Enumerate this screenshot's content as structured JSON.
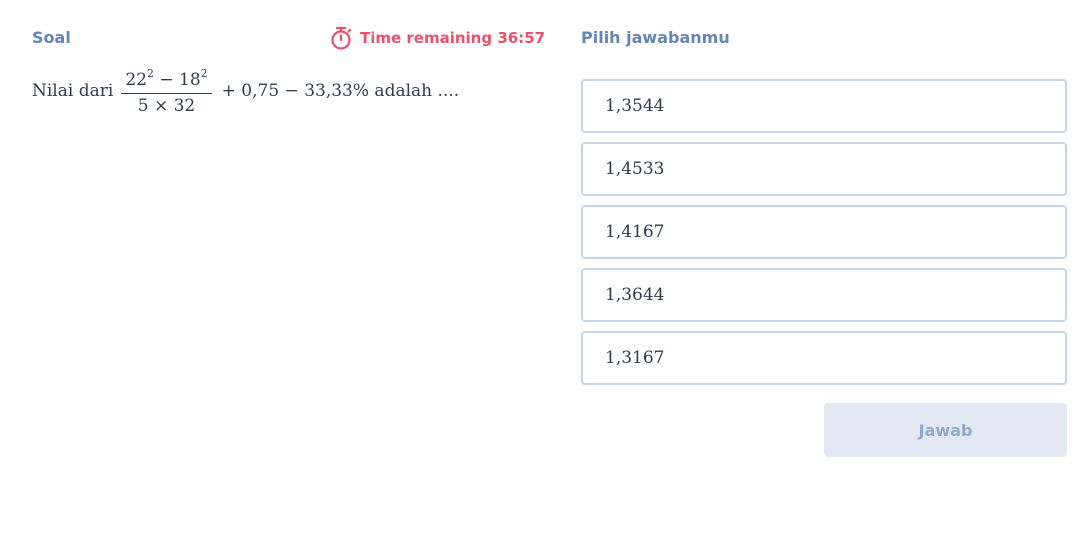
{
  "left_panel": {
    "title": "Soal",
    "timer_label": "Time remaining 36:57",
    "timer_icon": "stopwatch-icon",
    "question": {
      "prefix": "Nilai dari",
      "numerator_a": "22",
      "numerator_exp_a": "2",
      "numerator_op": " − ",
      "numerator_b": "18",
      "numerator_exp_b": "2",
      "denominator": "5 × 32",
      "suffix": "+ 0,75 − 33,33% adalah ...."
    }
  },
  "right_panel": {
    "title": "Pilih jawabanmu",
    "options": [
      "1,3544",
      "1,4533",
      "1,4167",
      "1,3644",
      "1,3167"
    ],
    "submit_label": "Jawab"
  },
  "colors": {
    "heading": "#6585b3",
    "timer": "#e8526e",
    "option_border": "#c7d6e6",
    "submit_bg": "#e2e9f3",
    "submit_text": "#8fa8cc"
  }
}
